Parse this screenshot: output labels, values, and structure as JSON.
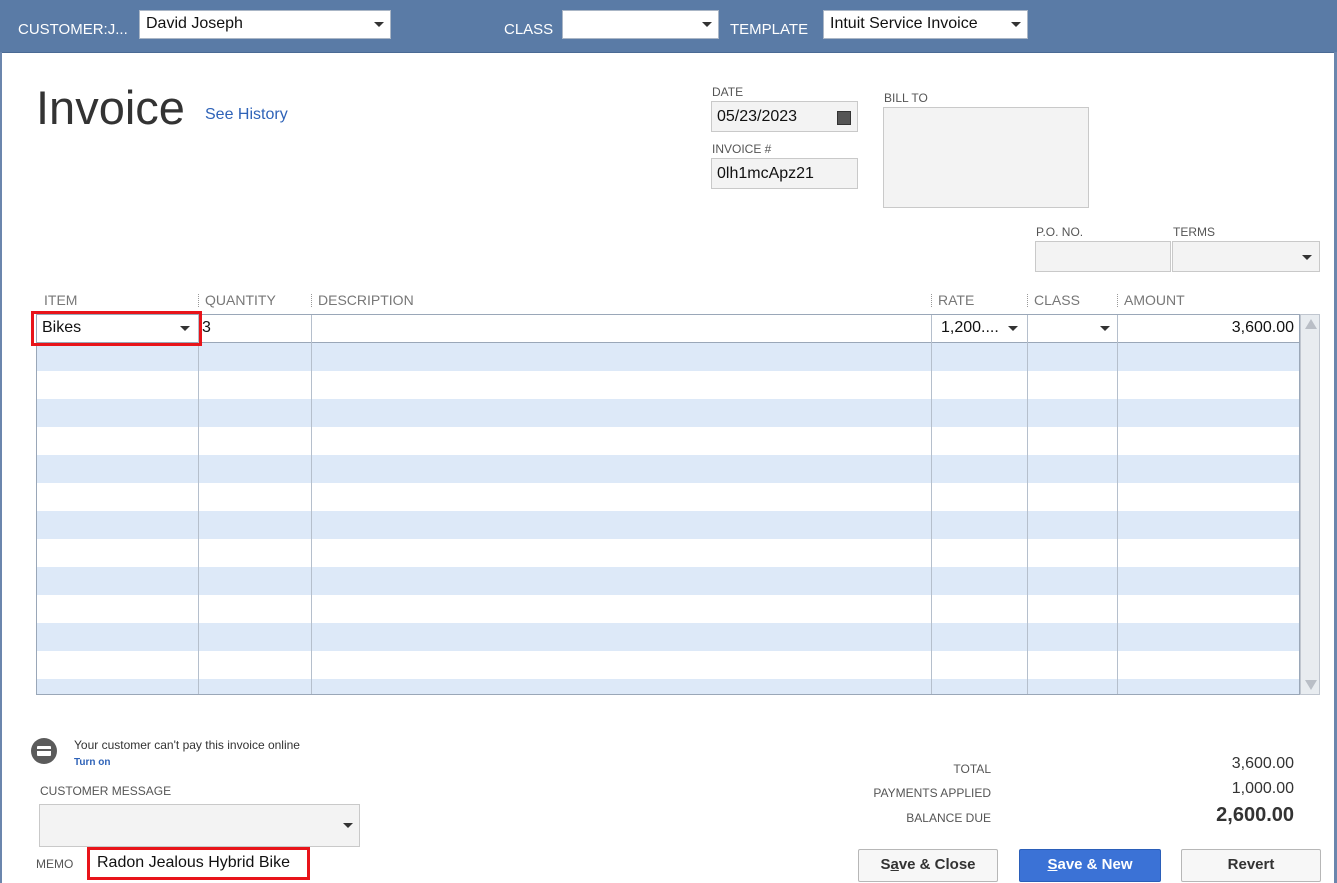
{
  "header": {
    "customer_label": "CUSTOMER:J...",
    "customer_value": "David Joseph",
    "class_label": "CLASS",
    "class_value": "",
    "template_label": "TEMPLATE",
    "template_value": "Intuit Service Invoice"
  },
  "form": {
    "title": "Invoice",
    "see_history": "See History",
    "date_label": "DATE",
    "date_value": "05/23/2023",
    "invoice_no_label": "INVOICE #",
    "invoice_no_value": "0lh1mcApz21",
    "bill_to_label": "BILL TO",
    "po_label": "P.O. NO.",
    "terms_label": "TERMS"
  },
  "grid": {
    "columns": [
      "ITEM",
      "QUANTITY",
      "DESCRIPTION",
      "RATE",
      "CLASS",
      "AMOUNT"
    ],
    "rows": [
      {
        "item": "Bikes",
        "quantity": "3",
        "description": "",
        "rate": "1,200....",
        "class": "",
        "amount": "3,600.00"
      }
    ]
  },
  "footer": {
    "online_msg": "Your customer can't pay this invoice online",
    "turn_on": "Turn on",
    "customer_message_label": "CUSTOMER MESSAGE",
    "memo_label": "MEMO",
    "memo_value": "Radon Jealous Hybrid Bike",
    "total_label": "TOTAL",
    "total_value": "3,600.00",
    "payments_label": "PAYMENTS APPLIED",
    "payments_value": "1,000.00",
    "balance_label": "BALANCE DUE",
    "balance_value": "2,600.00"
  },
  "buttons": {
    "save_close_pre": "S",
    "save_close_ul": "a",
    "save_close_post": "ve & Close",
    "save_new_ul": "S",
    "save_new_post": "ave & New",
    "revert": "Revert"
  },
  "icons": {
    "online_payment": "card-icon",
    "calendar": "calendar-icon",
    "dropdown": "chevron-down-icon"
  },
  "colors": {
    "header_bg": "#5a7ba6",
    "row_stripe": "#dde9f8",
    "highlight": "#e8141a",
    "primary_button": "#3b72d6",
    "link": "#2f63b8"
  }
}
